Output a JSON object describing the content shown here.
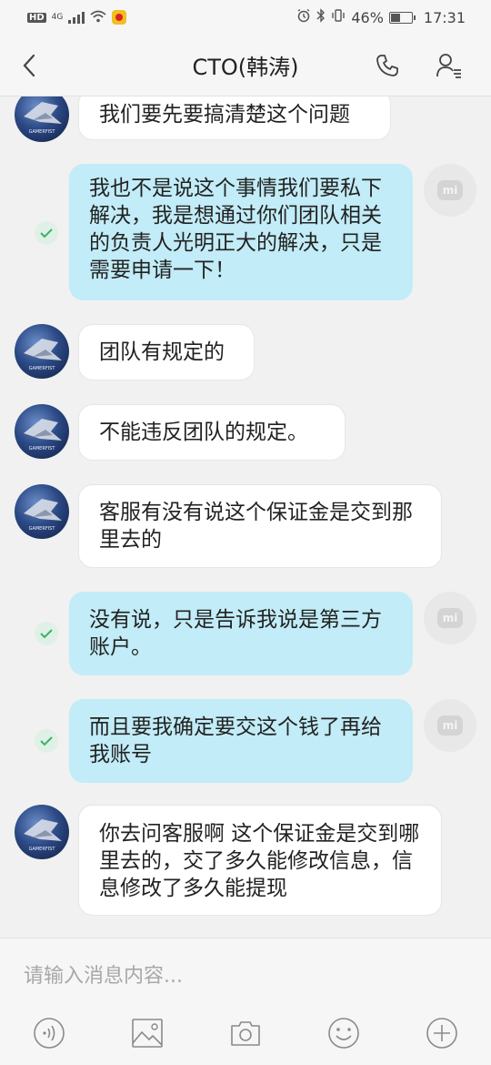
{
  "status_bar": {
    "hd": "HD",
    "network": "4G",
    "battery": "46%",
    "time": "17:31"
  },
  "header": {
    "title": "CTO(韩涛)"
  },
  "messages": [
    {
      "side": "in",
      "text": "我们要先要搞清楚这个问题"
    },
    {
      "side": "out",
      "text": "我也不是说这个事情我们要私下解决，我是想通过你们团队相关的负责人光明正大的解决，只是需要申请一下！"
    },
    {
      "side": "in",
      "text": "团队有规定的"
    },
    {
      "side": "in",
      "text": "不能违反团队的规定。"
    },
    {
      "side": "in",
      "text": "客服有没有说这个保证金是交到那里去的"
    },
    {
      "side": "out",
      "text": "没有说，只是告诉我说是第三方账户。"
    },
    {
      "side": "out",
      "text": "而且要我确定要交这个钱了再给我账号"
    },
    {
      "side": "in",
      "text": "你去问客服啊 这个保证金是交到哪里去的，交了多久能修改信息，信息修改了多久能提现"
    }
  ],
  "input": {
    "placeholder": "请输入消息内容..."
  },
  "toolbar": {
    "icons": [
      "voice-icon",
      "image-icon",
      "camera-icon",
      "emoji-icon",
      "plus-icon"
    ]
  },
  "colors": {
    "outgoing_bubble": "#c2ecf7",
    "incoming_bubble": "#ffffff",
    "background": "#f1f1f1"
  }
}
